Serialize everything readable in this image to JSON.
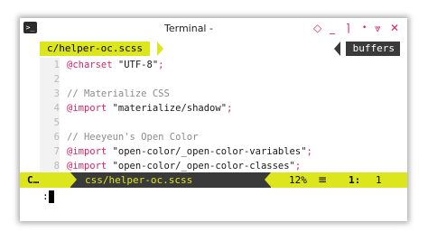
{
  "window": {
    "title": "Terminal -",
    "icon": "terminal-icon"
  },
  "controls": {
    "pin": "◇",
    "minimize": "_",
    "maximize": "⌉",
    "more": "•",
    "shade": "⩔",
    "close": "✕"
  },
  "tabline": {
    "active_tab": "c/helper-oc.scss",
    "buffers_label": "buffers"
  },
  "editor": {
    "lines": [
      {
        "num": "1",
        "parts": [
          {
            "t": "@charset",
            "c": "kw"
          },
          {
            "t": " \"UTF-8\"",
            "c": "str"
          },
          {
            "t": ";",
            "c": "semi"
          }
        ]
      },
      {
        "num": "2",
        "parts": []
      },
      {
        "num": "3",
        "parts": [
          {
            "t": "// Materialize CSS",
            "c": "cm"
          }
        ]
      },
      {
        "num": "4",
        "parts": [
          {
            "t": "@import",
            "c": "kw"
          },
          {
            "t": " \"materialize/shadow\"",
            "c": "str"
          },
          {
            "t": ";",
            "c": "semi"
          }
        ]
      },
      {
        "num": "5",
        "parts": []
      },
      {
        "num": "6",
        "parts": [
          {
            "t": "// Heeyeun's Open Color",
            "c": "cm"
          }
        ]
      },
      {
        "num": "7",
        "parts": [
          {
            "t": "@import",
            "c": "kw"
          },
          {
            "t": " \"open-color/_open-color-variables\"",
            "c": "str"
          },
          {
            "t": ";",
            "c": "semi"
          }
        ]
      },
      {
        "num": "8",
        "parts": [
          {
            "t": "@import",
            "c": "kw"
          },
          {
            "t": " \"open-color/_open-color-classes\"",
            "c": "str"
          },
          {
            "t": ";",
            "c": "semi"
          }
        ]
      }
    ]
  },
  "statusbar": {
    "mode": "C…",
    "filepath": "css/helper-oc.scss",
    "percent": "12%",
    "lines_icon": "≡",
    "line": "1:",
    "col": "1"
  },
  "cmdline": {
    "prompt": ":"
  },
  "colors": {
    "accent": "#dde61c",
    "keyword": "#e0245e",
    "dark": "#3a3a3a"
  }
}
